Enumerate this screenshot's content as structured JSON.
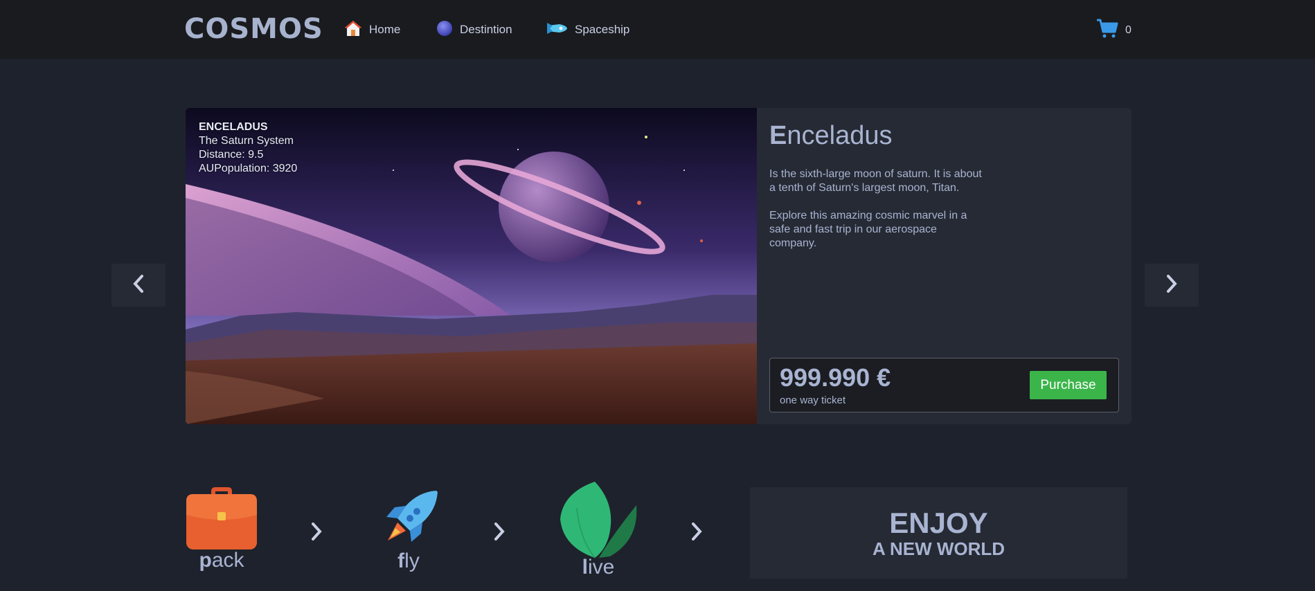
{
  "nav": {
    "logo": "COSMOS",
    "items": [
      {
        "label": "Home",
        "icon": "house-icon"
      },
      {
        "label": "Destintion",
        "icon": "planet-icon"
      },
      {
        "label": "Spaceship",
        "icon": "spaceship-icon"
      }
    ],
    "cart_count": "0",
    "cart_icon": "cart-icon"
  },
  "carousel": {
    "prev_icon": "chevron-left-icon",
    "next_icon": "chevron-right-icon",
    "caption": {
      "title": "ENCELADUS",
      "system": "The Saturn System",
      "distance": "Distance: 9.5",
      "population": "AUPopulation: 3920"
    },
    "heading_first": "E",
    "heading_rest": "nceladus",
    "description": [
      "Is the sixth-large moon of saturn. It is about a tenth of Saturn's largest moon, Titan.",
      "Explore this amazing cosmic marvel in a safe and fast trip in our aerospace company."
    ],
    "price": "999.990 €",
    "price_note": "one way ticket",
    "purchase_label": "Purchase"
  },
  "steps": [
    {
      "first": "p",
      "rest": "ack",
      "icon": "briefcase-icon"
    },
    {
      "first": "f",
      "rest": "ly",
      "icon": "rocket-icon"
    },
    {
      "first": "l",
      "rest": "ive",
      "icon": "leaf-icon"
    }
  ],
  "enjoy": {
    "line1": "ENJOY",
    "line2": "A NEW WORLD"
  },
  "colors": {
    "background": "#1e222c",
    "navbar": "#1a1b1f",
    "card": "#262a34",
    "text": "#a9b4d2",
    "purchase": "#3bb54a"
  }
}
